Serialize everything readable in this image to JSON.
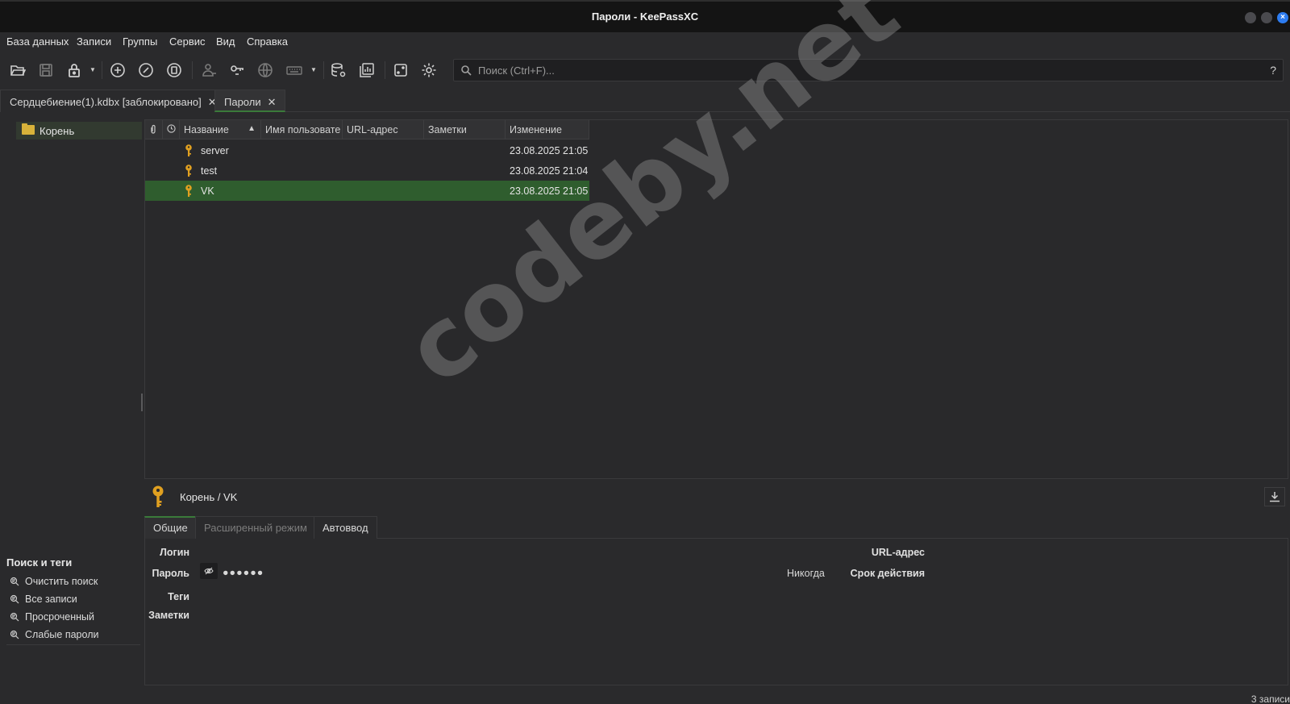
{
  "window": {
    "title": "Пароли - KeePassXC"
  },
  "menu": [
    "База данных",
    "Записи",
    "Группы",
    "Сервис",
    "Вид",
    "Справка"
  ],
  "toolbar": {
    "icons": [
      "open-database-icon",
      "save-database-icon",
      "lock-database-icon",
      "add-entry-icon",
      "edit-entry-icon",
      "delete-entry-icon",
      "copy-username-icon",
      "copy-password-icon",
      "copy-url-icon",
      "autotype-icon",
      "database-settings-icon",
      "reports-icon",
      "password-generator-icon",
      "settings-icon"
    ],
    "search_placeholder": "Поиск (Ctrl+F)...",
    "help": "?"
  },
  "tabs": [
    {
      "label": "Сердцебиение(1).kdbx [заблокировано]",
      "close": "✕"
    },
    {
      "label": "Пароли",
      "close": "✕"
    }
  ],
  "groups": {
    "root": "Корень"
  },
  "table": {
    "columns": [
      "Название",
      "Имя пользовате",
      "URL-адрес",
      "Заметки",
      "Изменение"
    ],
    "sort_indicator": "▲",
    "rows": [
      {
        "name": "server",
        "modified": "23.08.2025 21:05",
        "selected": false
      },
      {
        "name": "test",
        "modified": "23.08.2025 21:04",
        "selected": false
      },
      {
        "name": "VK",
        "modified": "23.08.2025 21:05",
        "selected": true
      }
    ]
  },
  "watermark": "codeby.net",
  "preview": {
    "path": "Корень / VK",
    "tabs": [
      "Общие",
      "Расширенный режим",
      "Автоввод"
    ],
    "fields": {
      "login_label": "Логин",
      "password_label": "Пароль",
      "password_value": "●●●●●●",
      "tags_label": "Теги",
      "notes_label": "Заметки",
      "url_label": "URL-адрес",
      "expiry_label": "Срок действия",
      "expiry_value": "Никогда"
    }
  },
  "search_tags": {
    "title": "Поиск и теги",
    "items": [
      "Очистить поиск",
      "Все записи",
      "Просроченный",
      "Слабые пароли"
    ]
  },
  "status": "3 записи",
  "colors": {
    "accent_green": "#2f5d2e",
    "key_gold": "#e0a020"
  }
}
